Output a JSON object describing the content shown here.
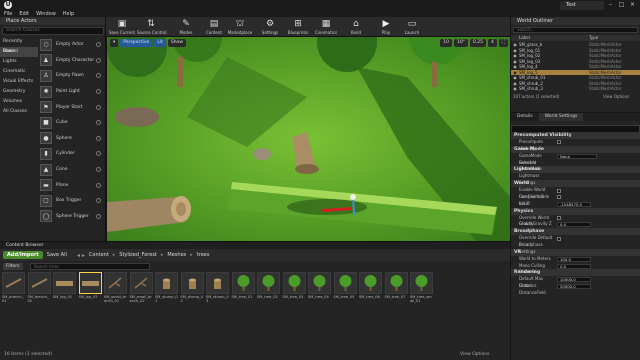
{
  "window": {
    "project_tab": "Test",
    "menu": [
      "File",
      "Edit",
      "Window",
      "Help"
    ]
  },
  "place": {
    "tab": "Place Actors",
    "search_placeholder": "Search Classes",
    "categories": [
      "Recently Placed",
      "Basic",
      "Lights",
      "Cinematic",
      "Visual Effects",
      "Geometry",
      "Volumes",
      "All Classes"
    ],
    "actors": [
      "Empty Actor",
      "Empty Character",
      "Empty Pawn",
      "Point Light",
      "Player Start",
      "Cube",
      "Sphere",
      "Cylinder",
      "Cone",
      "Plane",
      "Box Trigger",
      "Sphere Trigger"
    ]
  },
  "toolbar": {
    "buttons": [
      "Save Current",
      "Source Control",
      "Modes",
      "Content",
      "Marketplace",
      "Settings",
      "Blueprints",
      "Cinematics",
      "Build",
      "Play",
      "Launch"
    ]
  },
  "viewport": {
    "mode": "Perspective",
    "lit": "Lit",
    "show": "Show",
    "snap_translate": "10",
    "snap_rotate": "10°",
    "snap_scale": "0.25",
    "camera_speed": "4"
  },
  "outliner": {
    "tab": "World Outliner",
    "search_placeholder": "Search...",
    "col_label": "Label",
    "col_type": "Type",
    "rows": [
      {
        "label": "SM_grass_b",
        "type": "StaticMeshActor"
      },
      {
        "label": "SM_log_01",
        "type": "StaticMeshActor"
      },
      {
        "label": "SM_log_02",
        "type": "StaticMeshActor"
      },
      {
        "label": "SM_log_03",
        "type": "StaticMeshActor"
      },
      {
        "label": "SM_log_4",
        "type": "StaticMeshActor"
      },
      {
        "label": "SM_log_5",
        "type": "StaticMeshActor"
      },
      {
        "label": "SM_shrub_01",
        "type": "StaticMeshActor"
      },
      {
        "label": "SM_shrub_2",
        "type": "StaticMeshActor"
      },
      {
        "label": "SM_shrub_3",
        "type": "StaticMeshActor"
      }
    ],
    "selected_index": 5,
    "status": "107 actors (1 selected)",
    "view_options": "View Options"
  },
  "details": {
    "tabs": [
      "Details",
      "World Settings"
    ],
    "sections": [
      {
        "title": "Precomputed Visibility",
        "rows": [
          {
            "key": "Precompute Visibility",
            "kind": "check"
          }
        ]
      },
      {
        "title": "Game Mode",
        "rows": [
          {
            "key": "GameMode Override",
            "kind": "value",
            "value": "None"
          },
          {
            "key": "Selected GameMode",
            "kind": "text"
          }
        ]
      },
      {
        "title": "Lightmass",
        "rows": [
          {
            "key": "Lightmass Settings",
            "kind": "text"
          }
        ]
      },
      {
        "title": "World",
        "rows": [
          {
            "key": "Enable World Composition",
            "kind": "check"
          },
          {
            "key": "Use Client Side Level",
            "kind": "check"
          },
          {
            "key": "Kill Z",
            "kind": "value",
            "value": "-1048575.0"
          }
        ]
      },
      {
        "title": "Physics",
        "rows": [
          {
            "key": "Override World Gravity",
            "kind": "check"
          },
          {
            "key": "Global Gravity Z",
            "kind": "value",
            "value": "0.0"
          }
        ]
      },
      {
        "title": "Broadphase",
        "rows": [
          {
            "key": "Override Default Broad",
            "kind": "check"
          },
          {
            "key": "Broadphase Settings",
            "kind": "text"
          }
        ]
      },
      {
        "title": "VR",
        "rows": [
          {
            "key": "World to Meters",
            "kind": "value",
            "value": "100.0"
          },
          {
            "key": "Mono Culling Distance",
            "kind": "value",
            "value": "0.0"
          }
        ]
      },
      {
        "title": "Rendering",
        "rows": [
          {
            "key": "Default Max Distance",
            "kind": "value",
            "value": "10000.0"
          },
          {
            "key": "Global DistanceField",
            "kind": "value",
            "value": "20000.0"
          }
        ]
      }
    ]
  },
  "content": {
    "tab": "Content Browser",
    "add_import": "Add/Import",
    "save_all": "Save All",
    "crumbs": [
      "Content",
      "Stylized_Forest",
      "Meshes",
      "trees"
    ],
    "filters": "Filters",
    "search_placeholder": "Search trees",
    "assets": [
      "SM_branch_01",
      "SM_branch_02",
      "SM_log_01",
      "SM_log_02",
      "SM_small_branch_01",
      "SM_small_branch_02",
      "SM_stump_01",
      "SM_stump_02",
      "SM_stump_03",
      "SM_tree_01",
      "SM_tree_02",
      "SM_tree_03",
      "SM_tree_04",
      "SM_tree_05",
      "SM_tree_06",
      "SM_tree_07",
      "SM_tree_small_01"
    ],
    "selected_index": 3,
    "status": "16 items (1 selected)",
    "view_options": "View Options"
  }
}
